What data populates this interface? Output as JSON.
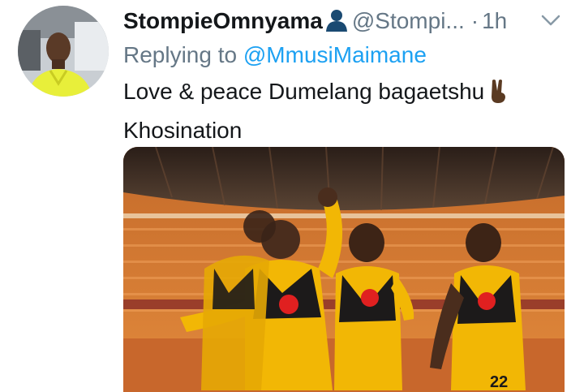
{
  "tweet": {
    "display_name": "StompieOmnyama",
    "handle": "@Stompi...",
    "separator": "·",
    "time": "1h",
    "reply_prefix": "Replying to",
    "reply_mention": "@MmusiMaimane",
    "text_line1": "Love & peace Dumelang bagaetshu",
    "text_line2": "Khosination",
    "emoji": "victory-hand-emoji",
    "jersey_number": "22"
  },
  "colors": {
    "handle_gray": "#657786",
    "link_blue": "#1da1f2",
    "text_dark": "#14171a",
    "kit_gold": "#f2b705"
  }
}
